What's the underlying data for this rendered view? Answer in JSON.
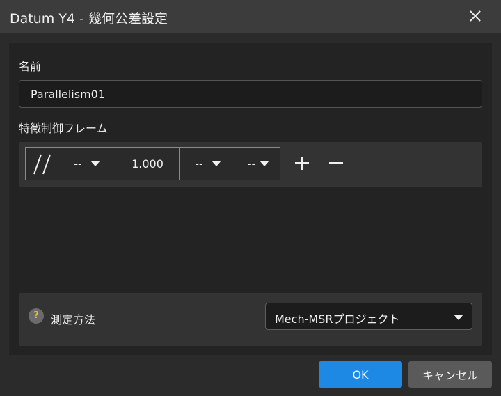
{
  "window": {
    "title": "Datum Y4 - 幾何公差設定"
  },
  "name_section": {
    "label": "名前",
    "value": "Parallelism01"
  },
  "fcf_section": {
    "label": "特徴制御フレーム",
    "symbol_icon": "parallelism-icon",
    "cells": [
      {
        "kind": "dropdown",
        "value": "--"
      },
      {
        "kind": "value",
        "value": "1.000"
      },
      {
        "kind": "dropdown",
        "value": "--"
      },
      {
        "kind": "dropdown",
        "value": "--"
      }
    ]
  },
  "method_section": {
    "help_glyph": "?",
    "label": "測定方法",
    "selected": "Mech-MSRプロジェクト"
  },
  "footer": {
    "ok_label": "OK",
    "cancel_label": "キャンセル"
  },
  "colors": {
    "accent": "#1e88e5",
    "help_question": "#e8c040"
  }
}
